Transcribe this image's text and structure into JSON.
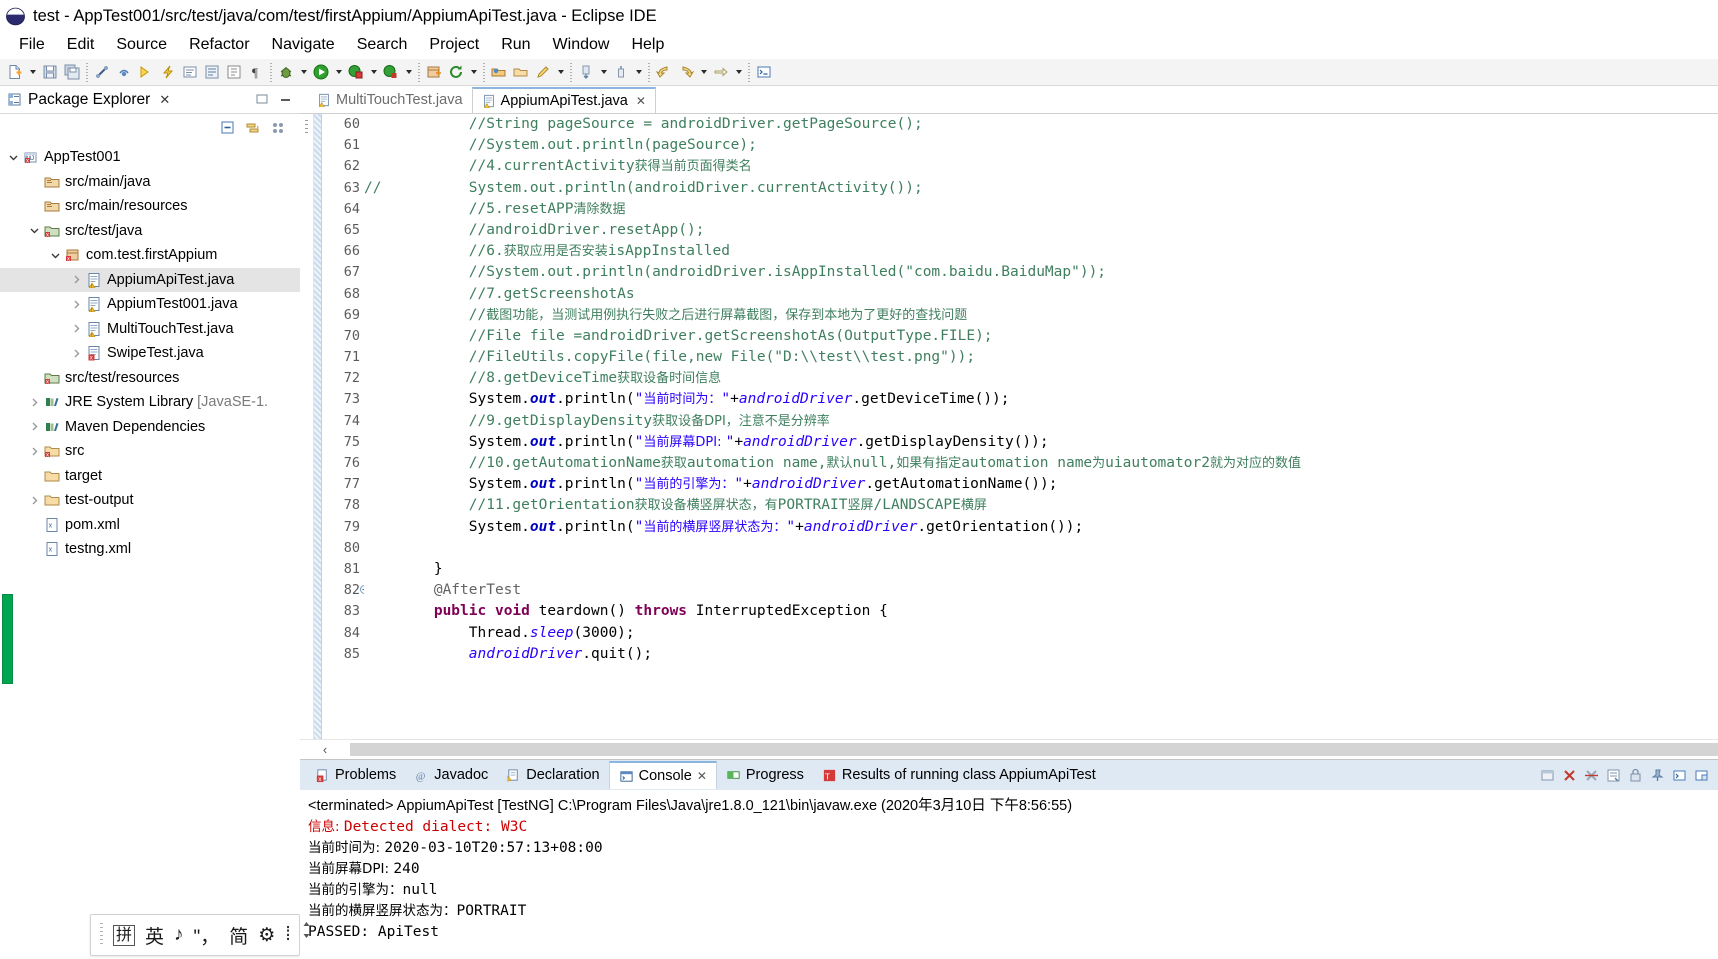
{
  "window": {
    "title": "test - AppTest001/src/test/java/com/test/firstAppium/AppiumApiTest.java - Eclipse IDE",
    "app_icon": "eclipse-logo-icon"
  },
  "menubar": {
    "items": [
      "File",
      "Edit",
      "Source",
      "Refactor",
      "Navigate",
      "Search",
      "Project",
      "Run",
      "Window",
      "Help"
    ]
  },
  "toolbar": {
    "buttons": [
      "new-java-file-icon",
      "new-dropdown-icon",
      "save-icon",
      "save-all-icon",
      "link-icon",
      "print-icon",
      "undo-icon",
      "build-icon",
      "externaltools-icon",
      "search-icon",
      "open-type-icon",
      "pilcrow-icon",
      "debug-icon",
      "debug-dropdown-icon",
      "run-icon",
      "run-dropdown-icon",
      "coverage-icon",
      "coverage-dropdown-icon",
      "profile-icon",
      "profile-dropdown-icon",
      "new-package-icon",
      "refresh-icon",
      "refresh-dropdown-icon",
      "open-perspective-icon",
      "open-folder-icon",
      "pencil-icon",
      "pencil-dropdown-icon",
      "next-annotation-icon",
      "next-annotation-dropdown-icon",
      "prev-annotation-icon",
      "prev-annotation-dropdown-icon",
      "back-icon",
      "forward-icon",
      "history-dropdown-icon",
      "forward-arrow-icon",
      "forward-arrow-dropdown-icon",
      "terminal-icon"
    ]
  },
  "package_explorer": {
    "title": "Package Explorer",
    "close_label": "✕",
    "minimize_label": "—",
    "view_buttons": [
      "collapse-all-icon",
      "link-with-editor-icon",
      "view-menu-icon"
    ],
    "tree": [
      {
        "label": "AppTest001",
        "indent": 0,
        "twist": "down",
        "icon": "java-project-icon",
        "selected": false
      },
      {
        "label": "src/main/java",
        "indent": 1,
        "twist": "none",
        "icon": "source-folder-icon",
        "selected": false
      },
      {
        "label": "src/main/resources",
        "indent": 1,
        "twist": "none",
        "icon": "source-folder-icon",
        "selected": false
      },
      {
        "label": "src/test/java",
        "indent": 1,
        "twist": "down",
        "icon": "test-source-folder-icon",
        "selected": false
      },
      {
        "label": "com.test.firstAppium",
        "indent": 2,
        "twist": "down",
        "icon": "package-icon",
        "selected": false
      },
      {
        "label": "AppiumApiTest.java",
        "indent": 3,
        "twist": "right",
        "icon": "java-warning-file-icon",
        "selected": true
      },
      {
        "label": "AppiumTest001.java",
        "indent": 3,
        "twist": "right",
        "icon": "java-warning-file-icon",
        "selected": false
      },
      {
        "label": "MultiTouchTest.java",
        "indent": 3,
        "twist": "right",
        "icon": "java-warning-file-icon",
        "selected": false
      },
      {
        "label": "SwipeTest.java",
        "indent": 3,
        "twist": "right",
        "icon": "java-error-file-icon",
        "selected": false
      },
      {
        "label": "src/test/resources",
        "indent": 1,
        "twist": "none",
        "icon": "test-source-folder-icon",
        "selected": false
      },
      {
        "label": "JRE System Library ",
        "label_dim": "[JavaSE-1.",
        "indent": 1,
        "twist": "right",
        "icon": "library-icon",
        "selected": false
      },
      {
        "label": "Maven Dependencies",
        "indent": 1,
        "twist": "right",
        "icon": "library-icon",
        "selected": false
      },
      {
        "label": "src",
        "indent": 1,
        "twist": "right",
        "icon": "folder-error-icon",
        "selected": false
      },
      {
        "label": "target",
        "indent": 1,
        "twist": "none",
        "icon": "folder-icon",
        "selected": false
      },
      {
        "label": "test-output",
        "indent": 1,
        "twist": "right",
        "icon": "folder-icon",
        "selected": false
      },
      {
        "label": "pom.xml",
        "indent": 1,
        "twist": "none",
        "icon": "xml-file-icon",
        "selected": false
      },
      {
        "label": "testng.xml",
        "indent": 1,
        "twist": "none",
        "icon": "xml-file-icon",
        "selected": false
      }
    ]
  },
  "ime_bar": {
    "items": [
      "拼",
      "英",
      "♪",
      "\"，",
      "简",
      "⚙",
      "⁞"
    ]
  },
  "editor": {
    "tabs": [
      {
        "label": "MultiTouchTest.java",
        "active": false,
        "icon": "java-file-icon"
      },
      {
        "label": "AppiumApiTest.java",
        "active": true,
        "icon": "java-file-icon",
        "close": "✕"
      }
    ],
    "first_line_number": 60,
    "fold_lines": [
      82
    ],
    "lines": [
      {
        "n": 60,
        "segments": [
          {
            "t": "            //String pageSource = androidDriver.getPageSource();",
            "c": "tok-cmt"
          }
        ]
      },
      {
        "n": 61,
        "segments": [
          {
            "t": "            //System.out.println(pageSource);",
            "c": "tok-cmt"
          }
        ]
      },
      {
        "n": 62,
        "segments": [
          {
            "t": "            //4.currentActivity",
            "c": "tok-cmt"
          },
          {
            "t": "获得当前页面得类名",
            "c": "tok-cmt-cn"
          }
        ]
      },
      {
        "n": 63,
        "segments": [
          {
            "t": "//",
            "c": "tok-cmt"
          },
          {
            "t": "          System.out.println(androidDriver.currentActivity());",
            "c": "tok-cmt"
          }
        ]
      },
      {
        "n": 64,
        "segments": [
          {
            "t": "            //5.resetAPP",
            "c": "tok-cmt"
          },
          {
            "t": "清除数据",
            "c": "tok-cmt-cn"
          }
        ]
      },
      {
        "n": 65,
        "segments": [
          {
            "t": "            //androidDriver.resetApp();",
            "c": "tok-cmt"
          }
        ]
      },
      {
        "n": 66,
        "segments": [
          {
            "t": "            //6.",
            "c": "tok-cmt"
          },
          {
            "t": "获取应用是否安装",
            "c": "tok-cmt-cn"
          },
          {
            "t": "isAppInstalled",
            "c": "tok-cmt"
          }
        ]
      },
      {
        "n": 67,
        "segments": [
          {
            "t": "            //System.out.println(androidDriver.isAppInstalled(\"com.baidu.BaiduMap\"));",
            "c": "tok-cmt"
          }
        ]
      },
      {
        "n": 68,
        "segments": [
          {
            "t": "            //7.getScreenshotAs",
            "c": "tok-cmt"
          }
        ]
      },
      {
        "n": 69,
        "segments": [
          {
            "t": "            //",
            "c": "tok-cmt"
          },
          {
            "t": "截图功能，当测试用例执行失败之后进行屏幕截图，保存到本地为了更好的查找问题",
            "c": "tok-cmt-cn"
          }
        ]
      },
      {
        "n": 70,
        "segments": [
          {
            "t": "            //File file =androidDriver.getScreenshotAs(OutputType.FILE);",
            "c": "tok-cmt"
          }
        ]
      },
      {
        "n": 71,
        "segments": [
          {
            "t": "            //FileUtils.copyFile(file,new File(\"D:\\\\test\\\\test.png\"));",
            "c": "tok-cmt"
          }
        ]
      },
      {
        "n": 72,
        "segments": [
          {
            "t": "            //8.getDeviceTime",
            "c": "tok-cmt"
          },
          {
            "t": "获取设备时间信息",
            "c": "tok-cmt-cn"
          }
        ]
      },
      {
        "n": 73,
        "segments": [
          {
            "t": "            System.",
            "c": "tok-pl"
          },
          {
            "t": "out",
            "c": "tok-fld"
          },
          {
            "t": ".println(",
            "c": "tok-pl"
          },
          {
            "t": "\"",
            "c": "tok-str"
          },
          {
            "t": "当前时间为：",
            "c": "tok-str-cn"
          },
          {
            "t": "\"",
            "c": "tok-str"
          },
          {
            "t": "+",
            "c": "tok-pl"
          },
          {
            "t": "androidDriver",
            "c": "tok-var"
          },
          {
            "t": ".getDeviceTime());",
            "c": "tok-pl"
          }
        ]
      },
      {
        "n": 74,
        "segments": [
          {
            "t": "            //9.getDisplayDensity",
            "c": "tok-cmt"
          },
          {
            "t": "获取设备DPI，注意不是分辨率",
            "c": "tok-cmt-cn"
          }
        ]
      },
      {
        "n": 75,
        "segments": [
          {
            "t": "            System.",
            "c": "tok-pl"
          },
          {
            "t": "out",
            "c": "tok-fld"
          },
          {
            "t": ".println(",
            "c": "tok-pl"
          },
          {
            "t": "\"",
            "c": "tok-str"
          },
          {
            "t": "当前屏幕DPI: ",
            "c": "tok-str-cn"
          },
          {
            "t": "\"",
            "c": "tok-str"
          },
          {
            "t": "+",
            "c": "tok-pl"
          },
          {
            "t": "androidDriver",
            "c": "tok-var"
          },
          {
            "t": ".getDisplayDensity());",
            "c": "tok-pl"
          }
        ]
      },
      {
        "n": 76,
        "segments": [
          {
            "t": "            //10.getAutomationName",
            "c": "tok-cmt"
          },
          {
            "t": "获取",
            "c": "tok-cmt-cn"
          },
          {
            "t": "automation name,",
            "c": "tok-cmt"
          },
          {
            "t": "默认",
            "c": "tok-cmt-cn"
          },
          {
            "t": "null,",
            "c": "tok-cmt"
          },
          {
            "t": "如果有指定",
            "c": "tok-cmt-cn"
          },
          {
            "t": "automation name",
            "c": "tok-cmt"
          },
          {
            "t": "为",
            "c": "tok-cmt-cn"
          },
          {
            "t": "uiautomator2",
            "c": "tok-cmt"
          },
          {
            "t": "就为对应的数值",
            "c": "tok-cmt-cn"
          }
        ]
      },
      {
        "n": 77,
        "segments": [
          {
            "t": "            System.",
            "c": "tok-pl"
          },
          {
            "t": "out",
            "c": "tok-fld"
          },
          {
            "t": ".println(",
            "c": "tok-pl"
          },
          {
            "t": "\"",
            "c": "tok-str"
          },
          {
            "t": "当前的引擎为：",
            "c": "tok-str-cn"
          },
          {
            "t": "\"",
            "c": "tok-str"
          },
          {
            "t": "+",
            "c": "tok-pl"
          },
          {
            "t": "androidDriver",
            "c": "tok-var"
          },
          {
            "t": ".getAutomationName());",
            "c": "tok-pl"
          }
        ]
      },
      {
        "n": 78,
        "segments": [
          {
            "t": "            //11.getOrientation",
            "c": "tok-cmt"
          },
          {
            "t": "获取设备横竖屏状态，有",
            "c": "tok-cmt-cn"
          },
          {
            "t": "PORTRAIT",
            "c": "tok-cmt"
          },
          {
            "t": "竖屏",
            "c": "tok-cmt-cn"
          },
          {
            "t": "/LANDSCAPE",
            "c": "tok-cmt"
          },
          {
            "t": "横屏",
            "c": "tok-cmt-cn"
          }
        ]
      },
      {
        "n": 79,
        "segments": [
          {
            "t": "            System.",
            "c": "tok-pl"
          },
          {
            "t": "out",
            "c": "tok-fld"
          },
          {
            "t": ".println(",
            "c": "tok-pl"
          },
          {
            "t": "\"",
            "c": "tok-str"
          },
          {
            "t": "当前的横屏竖屏状态为：",
            "c": "tok-str-cn"
          },
          {
            "t": "\"",
            "c": "tok-str"
          },
          {
            "t": "+",
            "c": "tok-pl"
          },
          {
            "t": "androidDriver",
            "c": "tok-var"
          },
          {
            "t": ".getOrientation());",
            "c": "tok-pl"
          }
        ]
      },
      {
        "n": 80,
        "segments": [
          {
            "t": "",
            "c": "tok-pl"
          }
        ]
      },
      {
        "n": 81,
        "segments": [
          {
            "t": "        }",
            "c": "tok-pl"
          }
        ]
      },
      {
        "n": 82,
        "segments": [
          {
            "t": "        @AfterTest",
            "c": "tok-ann"
          }
        ]
      },
      {
        "n": 83,
        "segments": [
          {
            "t": "        ",
            "c": "tok-pl"
          },
          {
            "t": "public",
            "c": "tok-kw"
          },
          {
            "t": " ",
            "c": "tok-pl"
          },
          {
            "t": "void",
            "c": "tok-kw"
          },
          {
            "t": " teardown() ",
            "c": "tok-pl"
          },
          {
            "t": "throws",
            "c": "tok-kw"
          },
          {
            "t": " InterruptedException {",
            "c": "tok-pl"
          }
        ]
      },
      {
        "n": 84,
        "segments": [
          {
            "t": "            Thread.",
            "c": "tok-pl"
          },
          {
            "t": "sleep",
            "c": "tok-var"
          },
          {
            "t": "(3000);",
            "c": "tok-pl"
          }
        ]
      },
      {
        "n": 85,
        "segments": [
          {
            "t": "            ",
            "c": "tok-pl"
          },
          {
            "t": "androidDriver",
            "c": "tok-var"
          },
          {
            "t": ".quit();",
            "c": "tok-pl"
          }
        ]
      }
    ],
    "hscroll_left_arrow": "‹"
  },
  "console": {
    "tabs": [
      {
        "label": "Problems",
        "active": false,
        "icon": "problems-icon"
      },
      {
        "label": "Javadoc",
        "active": false,
        "icon": "javadoc-icon"
      },
      {
        "label": "Declaration",
        "active": false,
        "icon": "declaration-icon"
      },
      {
        "label": "Console",
        "active": true,
        "icon": "console-icon",
        "close": "✕"
      },
      {
        "label": "Progress",
        "active": false,
        "icon": "progress-icon"
      },
      {
        "label": "Results of running class AppiumApiTest",
        "active": false,
        "icon": "testng-results-icon"
      }
    ],
    "tools": [
      "minimize-icon",
      "terminate-icon",
      "remove-all-terminated-icon",
      "clear-console-icon",
      "scroll-lock-icon",
      "pin-console-icon",
      "display-selected-console-icon",
      "open-console-icon"
    ],
    "header": "<terminated> AppiumApiTest [TestNG] C:\\Program Files\\Java\\jre1.8.0_121\\bin\\javaw.exe (2020年3月10日 下午8:56:55)",
    "output": [
      {
        "text_cn": "信息: ",
        "text": "Detected dialect: W3C",
        "error": true
      },
      {
        "text_cn": "当前时间为: ",
        "text": "2020-03-10T20:57:13+08:00",
        "error": false
      },
      {
        "text_cn": "当前屏幕DPI: ",
        "text": "240",
        "error": false
      },
      {
        "text_cn": "当前的引擎为：",
        "text": "null",
        "error": false
      },
      {
        "text_cn": "当前的横屏竖屏状态为：",
        "text": "PORTRAIT",
        "error": false
      },
      {
        "text_cn": "",
        "text": "PASSED: ApiTest",
        "error": false
      }
    ]
  },
  "colors": {
    "comment": "#3f7f5f",
    "string": "#2a00ff",
    "keyword": "#7f0055",
    "field": "#0000c0",
    "annotation": "#646464",
    "error_red": "#cc0000",
    "tab_active_accent": "#8ab6dd",
    "console_tabbar": "#dfe9f4",
    "selection_grey": "#e4e4e4"
  }
}
